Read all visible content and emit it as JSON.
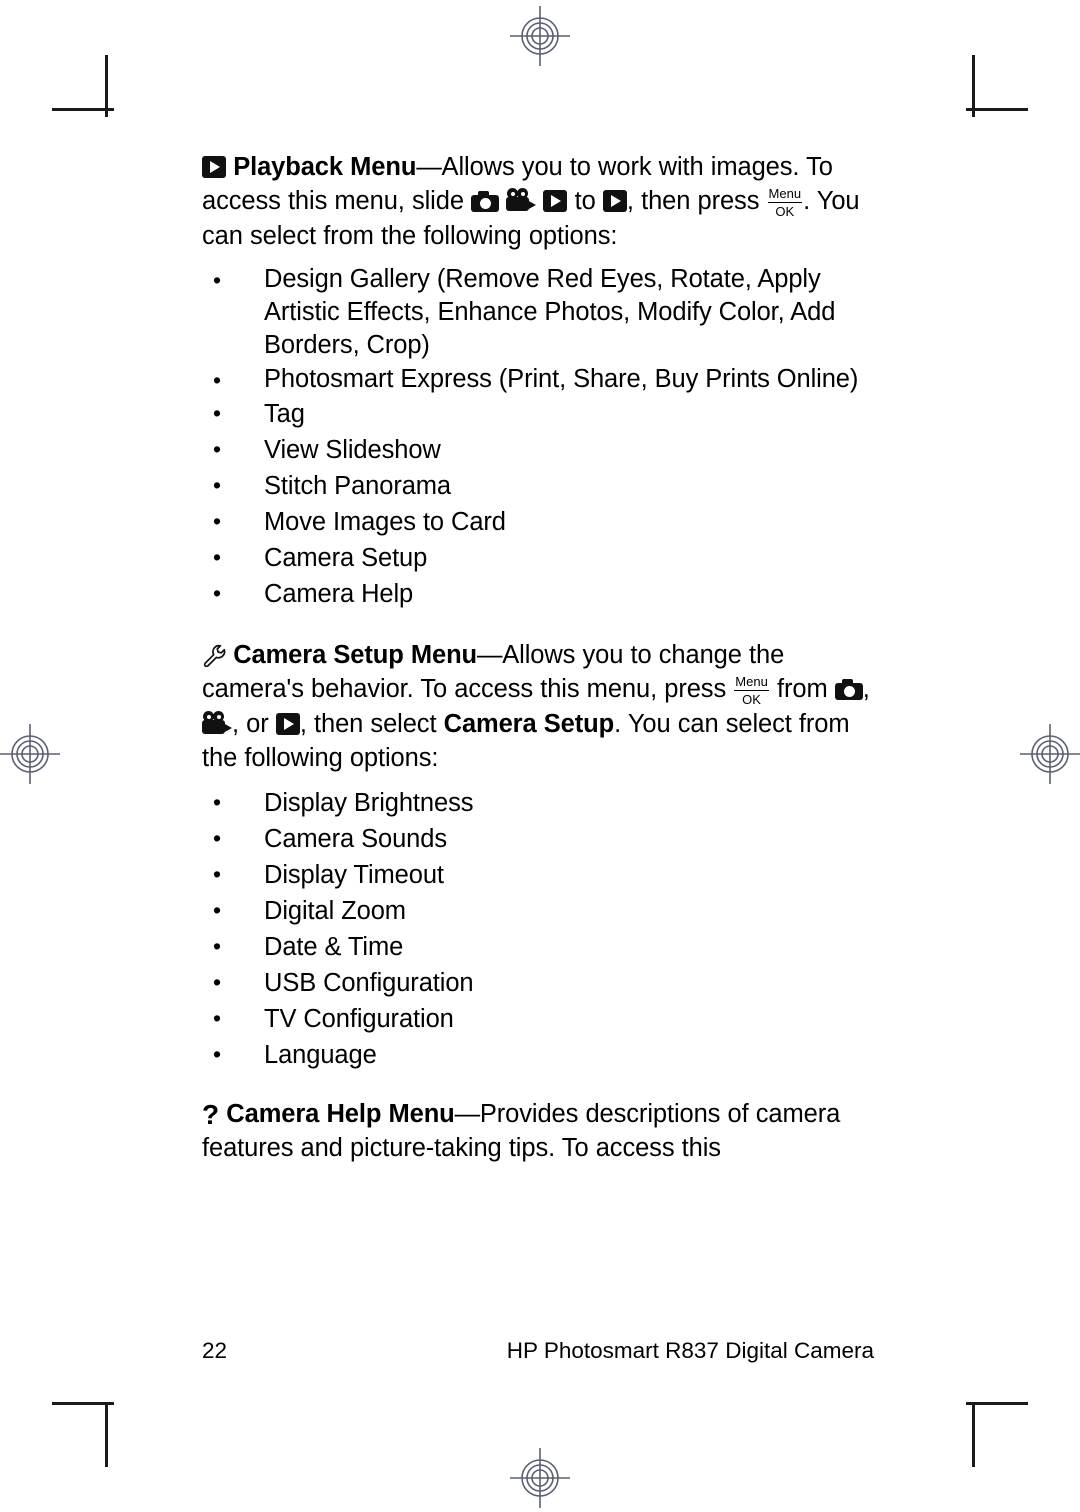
{
  "document": {
    "page_number": "22",
    "footer_title": "HP Photosmart R837 Digital Camera"
  },
  "sections": [
    {
      "id": "playback-menu",
      "icon": "playback-icon",
      "heading": "Playback Menu",
      "dash": "—",
      "intro_part1": "Allows you to work with images. To access this menu, slide ",
      "intro_part2": " to ",
      "intro_part3": ", then press ",
      "intro_part4": ". You can select from the following options:",
      "menu_icon_top": "Menu",
      "menu_icon_bottom": "OK",
      "options": [
        "Design Gallery (Remove Red Eyes, Rotate, Apply Artistic Effects, Enhance Photos, Modify Color, Add Borders, Crop)",
        "Photosmart Express (Print, Share, Buy Prints Online)",
        "Tag",
        "View Slideshow",
        "Stitch Panorama",
        "Move Images to Card",
        "Camera Setup",
        "Camera Help"
      ]
    },
    {
      "id": "camera-setup-menu",
      "icon": "wrench-icon",
      "heading": "Camera Setup Menu",
      "dash": "—",
      "intro_part1": "Allows you to change the camera's behavior. To access this menu, press ",
      "intro_part2": " from ",
      "intro_part3": ", ",
      "intro_part4": ", or ",
      "intro_part5": ", then select ",
      "intro_bold": "Camera Setup",
      "intro_part6": ". You can select from the following options:",
      "menu_icon_top": "Menu",
      "menu_icon_bottom": "OK",
      "options": [
        "Display Brightness",
        "Camera Sounds",
        "Display Timeout",
        "Digital Zoom",
        "Date & Time",
        "USB Configuration",
        "TV Configuration",
        "Language"
      ]
    },
    {
      "id": "camera-help-menu",
      "icon": "question-mark-icon",
      "icon_glyph": "?",
      "heading": "Camera Help Menu",
      "dash": "—",
      "intro_part1": "Provides descriptions of camera features and picture-taking tips. To access this"
    }
  ],
  "colors": {
    "text": "#000000",
    "background": "#ffffff",
    "icon": "#111111",
    "registration_mark": "#5a5f72",
    "crop_mark": "#1a1a1a"
  }
}
